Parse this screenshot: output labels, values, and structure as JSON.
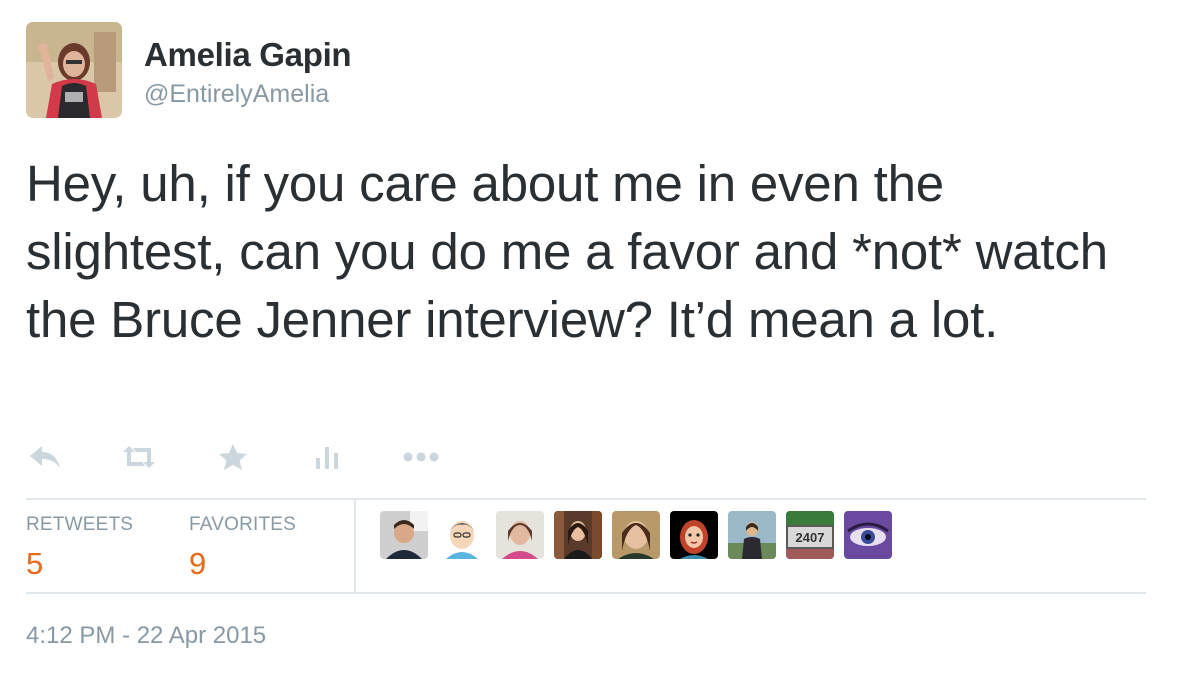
{
  "author": {
    "name": "Amelia Gapin",
    "handle": "@EntirelyAmelia"
  },
  "tweet": {
    "text": "Hey, uh, if you care about me in even the slightest, can you do me a favor and *not* watch the Bruce Jenner interview? It’d mean a lot."
  },
  "actions": {
    "icons": [
      "reply-icon",
      "retweet-icon",
      "favorite-star-icon",
      "analytics-icon",
      "more-icon"
    ]
  },
  "stats": {
    "retweets_label": "RETWEETS",
    "retweets_count": "5",
    "favorites_label": "FAVORITES",
    "favorites_count": "9"
  },
  "favoriters": {
    "badge_text": "2407"
  },
  "timestamp": "4:12 PM - 22 Apr 2015",
  "colors": {
    "text": "#292f33",
    "muted": "#8899a6",
    "count": "#e86a18",
    "divider": "#e1e8ed",
    "icon": "#ccd6dd"
  }
}
